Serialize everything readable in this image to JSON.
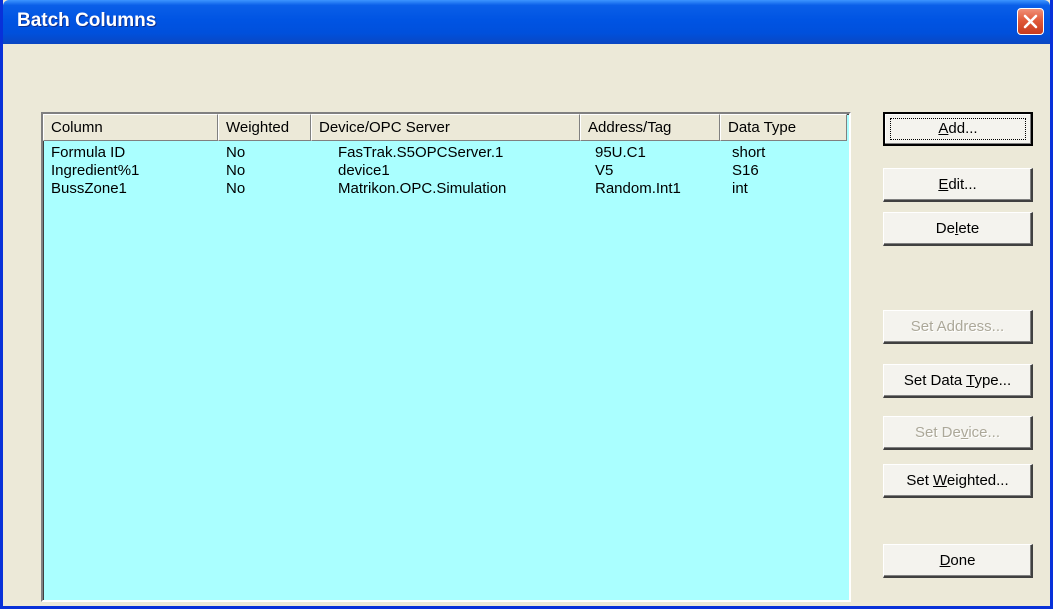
{
  "window": {
    "title": "Batch Columns"
  },
  "list": {
    "columns": [
      "Column",
      "Weighted",
      "Device/OPC Server",
      "Address/Tag",
      "Data Type"
    ],
    "rows": [
      [
        "Formula ID",
        "No",
        "FasTrak.S5OPCServer.1",
        "95U.C1",
        "short"
      ],
      [
        "Ingredient%1",
        "No",
        "device1",
        "V5",
        "S16"
      ],
      [
        "BussZone1",
        "No",
        "Matrikon.OPC.Simulation",
        "Random.Int1",
        "int"
      ]
    ],
    "background_color": "#aaffff"
  },
  "buttons": {
    "add": {
      "pre": "",
      "key": "A",
      "post": "dd..."
    },
    "edit": {
      "pre": "",
      "key": "E",
      "post": "dit..."
    },
    "delete": {
      "pre": "De",
      "key": "l",
      "post": "ete"
    },
    "set_address": {
      "pre": "Set Address...",
      "key": "",
      "post": ""
    },
    "set_data_type": {
      "pre": "Set Data ",
      "key": "T",
      "post": "ype..."
    },
    "set_device": {
      "pre": "Set De",
      "key": "v",
      "post": "ice..."
    },
    "set_weighted": {
      "pre": "Set ",
      "key": "W",
      "post": "eighted..."
    },
    "done": {
      "pre": "",
      "key": "D",
      "post": "one"
    }
  },
  "icons": {
    "close": "close-icon"
  }
}
